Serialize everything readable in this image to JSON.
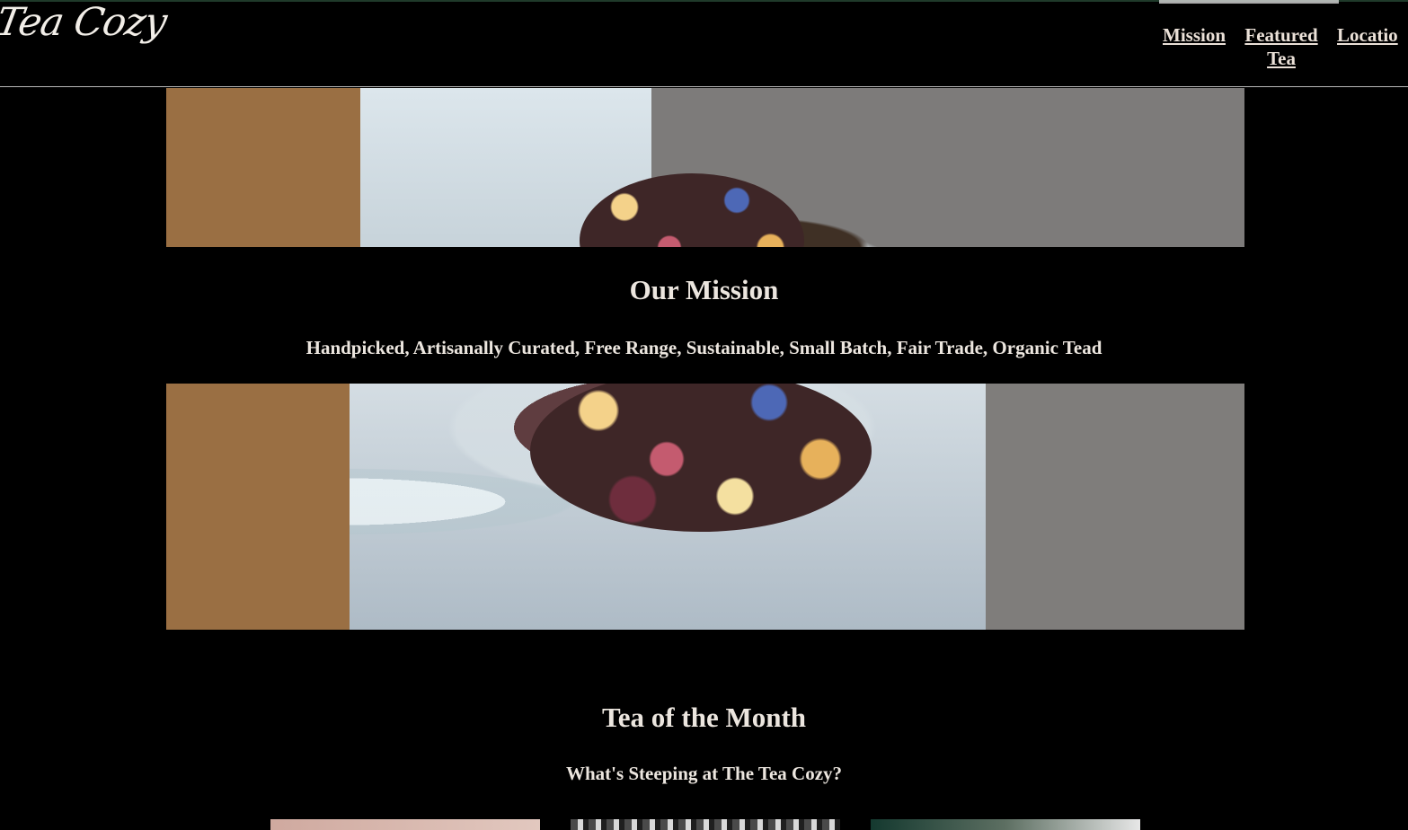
{
  "header": {
    "logo": "Tea Cozy",
    "nav": [
      {
        "label": "Mission"
      },
      {
        "label": "Featured Tea"
      },
      {
        "label": "Locatio"
      }
    ]
  },
  "mission": {
    "title": "Our Mission",
    "description": "Handpicked, Artisanally Curated, Free Range, Sustainable, Small Batch, Fair Trade, Organic Tead"
  },
  "tea_of_month": {
    "title": "Tea of the Month",
    "subtitle": "What's Steeping at The Tea Cozy?"
  },
  "images": {
    "hero_icon": "tea-jar-image",
    "card_icons": [
      "tea-card-image",
      "tea-card-image",
      "tea-card-image"
    ]
  },
  "colors": {
    "background": "#000000",
    "text": "#ece6df",
    "header_rule": "#b8b8b8"
  }
}
